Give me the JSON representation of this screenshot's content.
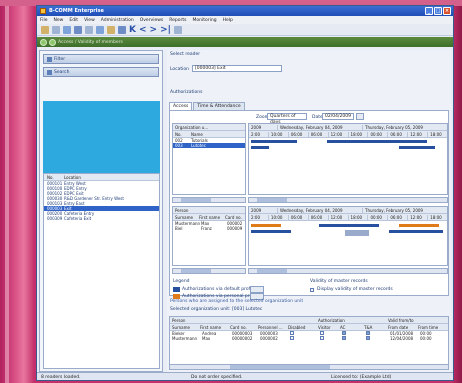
{
  "window": {
    "title": "B-COMM Enterprise",
    "menu": [
      "File",
      "New",
      "Edit",
      "View",
      "Administration",
      "Overviews",
      "Reports",
      "Monitoring",
      "Help"
    ],
    "nav_breadcrumb": "Access / Validity of members"
  },
  "left_panel": {
    "filter_label": "Filter",
    "search_label": "Search",
    "list_headers": [
      "No.",
      "Location"
    ],
    "list_rows": [
      {
        "no": "000101",
        "location": "Entry West"
      },
      {
        "no": "000100",
        "location": "EDPC Entry"
      },
      {
        "no": "000102",
        "location": "EDPC Exit"
      },
      {
        "no": "000030",
        "location": "R&D Gardener Str. Entry West"
      },
      {
        "no": "000103",
        "location": "Entry East"
      },
      {
        "no": "000003",
        "location": "Exit",
        "selected": true
      },
      {
        "no": "000200",
        "location": "Cafeteria Entry"
      },
      {
        "no": "000309",
        "location": "Cafeteria Exit"
      }
    ]
  },
  "right_panel": {
    "select_reader_label": "Select reader",
    "location_label": "Location",
    "location_value": "[000003] Exit",
    "authorizations_label": "Authorizations",
    "tabs": [
      "Access",
      "Time & Attendance"
    ],
    "zoom_label": "Zoom",
    "zoom_value": "Quarters of days",
    "date_label": "Date",
    "date_value": "02/04/2009",
    "org_header": "Organization u...",
    "org_cols": [
      "No.",
      "Name"
    ],
    "org_rows": [
      {
        "no": "002",
        "name": "Tutorials"
      },
      {
        "no": "003",
        "name": "Lutotec",
        "selected": true
      }
    ],
    "day_headers": [
      "2009",
      "Wednesday, February 04, 2009",
      "Thursday, February 05, 2009"
    ],
    "time_ticks": [
      "2:00",
      "10:00",
      "06:00",
      "06:00",
      "12:00",
      "18:00",
      "00:00",
      "06:00",
      "12:00",
      "18:00"
    ],
    "person_header": "Person",
    "person_cols": [
      "Surname",
      "First name",
      "Card no."
    ],
    "person_rows": [
      {
        "surname": "Mustermann",
        "first": "Max",
        "card": "000002"
      },
      {
        "surname": "Biel",
        "first": "Franz",
        "card": "000009"
      }
    ],
    "legend_title": "Legend",
    "legend_items": [
      "Authorizations via default profiles",
      "Authorizations via personal profiles"
    ],
    "validity_title": "Validity of master records",
    "validity_checkbox": "Display validity of master records",
    "persons_assigned_title": "Persons who are assigned to the selected organization unit",
    "selected_org_label": "Selected organization unit: [003] Lutotec",
    "bottom_header_groups": [
      "Person",
      "Authorization",
      "Valid from/to"
    ],
    "bottom_cols": [
      "Surname",
      "First name",
      "Card no.",
      "Personnel ...",
      "Disabled",
      "Visitor",
      "AC",
      "T&A",
      "From date",
      "From time"
    ],
    "bottom_rows": [
      {
        "surname": "Bieker",
        "first": "Andrea",
        "card": "00000003",
        "pers": "0000003",
        "from": "01/01/2008",
        "time": "00:00"
      },
      {
        "surname": "Mustermann",
        "first": "Max",
        "card": "00000002",
        "pers": "0000002",
        "from": "12/04/2008",
        "time": "00:00"
      }
    ]
  },
  "status": {
    "left": "8 readers loaded.",
    "center": "Do not order specified.",
    "right": "Licensed to: (Example Ltd)"
  },
  "colors": {
    "accent": "#2f63c8",
    "bar_blue": "#27509f",
    "bar_orange": "#e07b1a",
    "left_blue_area": "#2ea9e0"
  }
}
